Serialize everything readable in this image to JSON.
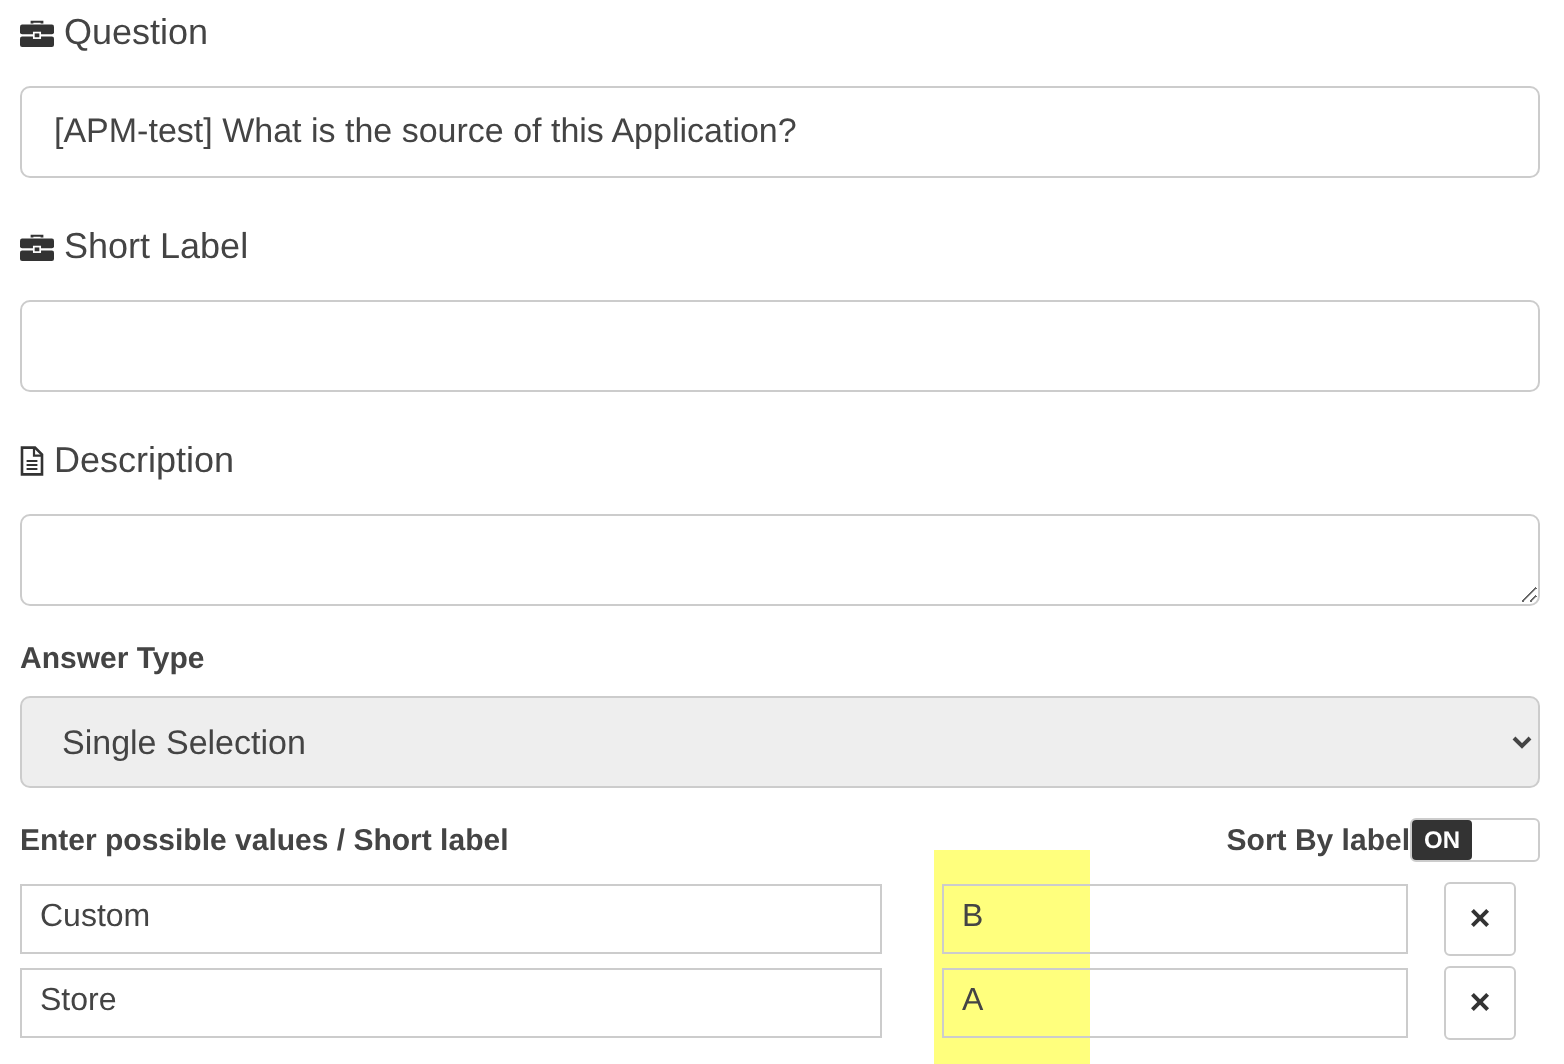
{
  "question": {
    "label": "Question",
    "value": "[APM-test] What is the source of this Application?"
  },
  "short_label": {
    "label": "Short Label"
  },
  "description": {
    "label": "Description"
  },
  "answer_type": {
    "label": "Answer Type",
    "value": "Single Selection",
    "disabled": true
  },
  "values": {
    "label": "Enter possible values / Short label",
    "sort_toggle": {
      "label": "Sort By label",
      "state_text": "ON",
      "on": true
    },
    "highlight_short_labels": true,
    "rows": [
      {
        "value": "Custom",
        "short_label": "B",
        "remove": "×"
      },
      {
        "value": "Store",
        "short_label": "A",
        "remove": "×"
      }
    ]
  }
}
